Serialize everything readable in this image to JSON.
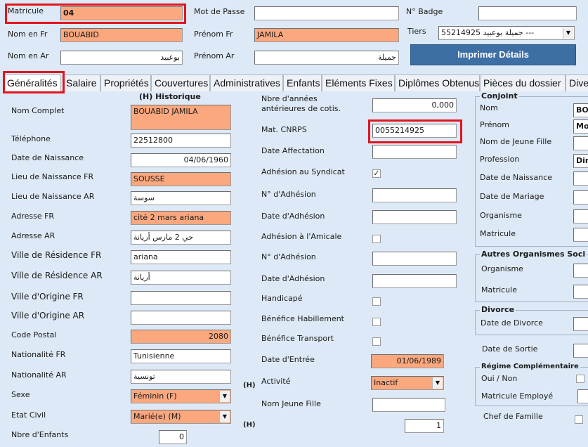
{
  "header": {
    "matricule": {
      "label": "Matricule",
      "value": "04"
    },
    "mot_de_passe": {
      "label": "Mot de Passe",
      "value": ""
    },
    "badge": {
      "label": "N° Badge",
      "value": ""
    },
    "nom_fr": {
      "label": "Nom en Fr",
      "value": "BOUABID"
    },
    "prenom_fr": {
      "label": "Prénom Fr",
      "value": "JAMILA"
    },
    "tiers": {
      "label": "Tiers",
      "value": "55214925 جميلة بوعبيد ---"
    },
    "nom_ar": {
      "label": "Nom en Ar",
      "value": "بوعبيد"
    },
    "prenom_ar": {
      "label": "Prénom Ar",
      "value": "جميلة"
    },
    "print_button": "Imprimer Détails"
  },
  "tabs": [
    "Généralités",
    "Salaire",
    "Propriétés",
    "Couvertures",
    "Administratives",
    "Enfants",
    "Eléments Fixes",
    "Diplômes Obtenus",
    "Pièces du dossier",
    "Divers"
  ],
  "col1": {
    "historique": "(H) Historique",
    "nom_complet": {
      "label": "Nom Complet",
      "value": "BOUABID JAMILA"
    },
    "telephone": {
      "label": "Téléphone",
      "value": "22512800"
    },
    "date_naissance": {
      "label": "Date de Naissance",
      "value": "04/06/1960"
    },
    "lieu_naissance_fr": {
      "label": "Lieu de Naissance FR",
      "value": "SOUSSE"
    },
    "lieu_naissance_ar": {
      "label": "Lieu de Naissance AR",
      "value": "سوسة"
    },
    "adresse_fr": {
      "label": "Adresse FR",
      "value": "cité 2 mars ariana"
    },
    "adresse_ar": {
      "label": "Adresse AR",
      "value": "حي 2 مارس أريانة"
    },
    "ville_res_fr": {
      "label": "Ville de Résidence FR",
      "value": "ariana"
    },
    "ville_res_ar": {
      "label": "Ville de Résidence AR",
      "value": "أريانة"
    },
    "ville_orig_fr": {
      "label": "Ville d'Origine FR",
      "value": ""
    },
    "ville_orig_ar": {
      "label": "Ville d'Origine AR",
      "value": ""
    },
    "code_postal": {
      "label": "Code Postal",
      "value": "2080"
    },
    "nationalite_fr": {
      "label": "Nationalité FR",
      "value": "Tunisienne"
    },
    "nationalite_ar": {
      "label": "Nationalité AR",
      "value": "تونسية"
    },
    "sexe": {
      "label": "Sexe",
      "value": "Féminin (F)",
      "h": "(H)"
    },
    "etat_civil": {
      "label": "Etat Civil",
      "value": "Marié(e) (M)"
    },
    "nbre_enfants": {
      "label": "Nbre d'Enfants",
      "value": "0",
      "h": "(H)"
    }
  },
  "col2": {
    "nbre_annees": {
      "label": "Nbre d'années antérieures de cotis.",
      "value": "0,000"
    },
    "mat_cnrps": {
      "label": "Mat. CNRPS",
      "value": "0055214925"
    },
    "date_affectation": {
      "label": "Date Affectation",
      "value": ""
    },
    "adhesion_syndicat": {
      "label": "Adhésion au Syndicat",
      "checked": true
    },
    "n_adhesion_1": {
      "label": "N° d'Adhésion",
      "value": ""
    },
    "date_adhesion_1": {
      "label": "Date d'Adhésion",
      "value": ""
    },
    "adhesion_amicale": {
      "label": "Adhésion à l'Amicale",
      "checked": false
    },
    "n_adhesion_2": {
      "label": "N° d'Adhésion",
      "value": ""
    },
    "date_adhesion_2": {
      "label": "Date d'Adhésion",
      "value": ""
    },
    "handicape": {
      "label": "Handicapé",
      "checked": false
    },
    "benef_habillement": {
      "label": "Bénéfice Habillement",
      "checked": false
    },
    "benef_transport": {
      "label": "Bénéfice Transport",
      "checked": false
    },
    "date_entree": {
      "label": "Date d'Entrée",
      "value": "01/06/1989"
    },
    "activite": {
      "label": "Activité",
      "value": "Inactif"
    },
    "nom_jeune_fille": {
      "label": "Nom Jeune Fille",
      "value": ""
    },
    "last_value": "1"
  },
  "col3": {
    "conjoint": {
      "title": "Conjoint",
      "nom": {
        "label": "Nom",
        "value": "BO"
      },
      "prenom": {
        "label": "Prénom",
        "value": "Mo"
      },
      "nom_jeune_fille": {
        "label": "Nom de Jeune Fille",
        "value": ""
      },
      "profession": {
        "label": "Profession",
        "value": "Dir"
      },
      "date_naissance": {
        "label": "Date de Naissance",
        "value": ""
      },
      "date_mariage": {
        "label": "Date de Mariage",
        "value": ""
      },
      "organisme": {
        "label": "Organisme",
        "value": ""
      },
      "matricule": {
        "label": "Matricule",
        "value": ""
      }
    },
    "autres": {
      "title": "Autres Organismes Soci",
      "organisme": {
        "label": "Organisme",
        "value": ""
      },
      "matricule": {
        "label": "Matricule",
        "value": ""
      }
    },
    "divorce": {
      "title": "Divorce",
      "date_divorce": {
        "label": "Date de Divorce",
        "value": ""
      }
    },
    "date_sortie": {
      "label": "Date de Sortie",
      "value": ""
    },
    "regime": {
      "title": "Régime Complémentaire",
      "oui_non": {
        "label": "Oui / Non",
        "checked": false
      },
      "matricule_employe": {
        "label": "Matricule Employé",
        "value": ""
      }
    },
    "chef_famille": {
      "label": "Chef de Famille",
      "checked": false
    }
  },
  "colors": {
    "background": "#dde9f6",
    "highlight": "#fca87f",
    "annotation": "#e3151c",
    "button": "#3d6fa5"
  }
}
